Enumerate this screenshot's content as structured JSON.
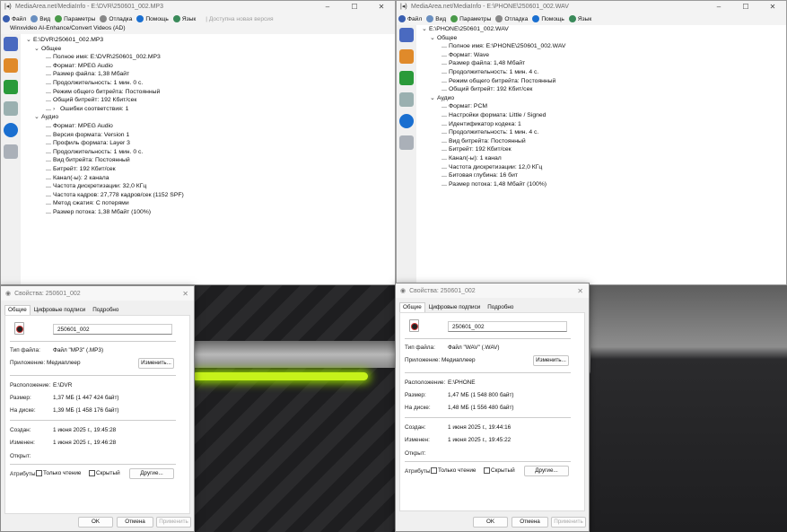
{
  "left_info": {
    "title": "MediaArea.net/MediaInfo - E:\\DVR\\250601_002.MP3",
    "menu": [
      "Файл",
      "Вид",
      "Параметры",
      "Отладка",
      "Помощь",
      "Язык"
    ],
    "update_notice": "| Доступна новая версия",
    "ad": "Winxvideo AI-Enhance/Convert Videos (AD)",
    "tree": [
      {
        "level": 0,
        "text": "E:\\DVR\\250601_002.MP3",
        "caret": "⌄"
      },
      {
        "level": 1,
        "text": "Общее",
        "caret": "⌄"
      },
      {
        "level": 2,
        "text": "Полное имя: E:\\DVR\\250601_002.MP3"
      },
      {
        "level": 2,
        "text": "Формат: MPEG Audio"
      },
      {
        "level": 2,
        "text": "Размер файла: 1,38 Мбайт"
      },
      {
        "level": 2,
        "text": "Продолжительность: 1 мин. 0 с."
      },
      {
        "level": 2,
        "text": "Режим общего битрейта: Постоянный"
      },
      {
        "level": 2,
        "text": "Общий битрейт: 192 Кбит/сек"
      },
      {
        "level": 2,
        "text": "Ошибки соответствия: 1",
        "caret": "›"
      },
      {
        "level": 1,
        "text": "Аудио",
        "caret": "⌄"
      },
      {
        "level": 2,
        "text": "Формат: MPEG Audio"
      },
      {
        "level": 2,
        "text": "Версия формата: Version 1"
      },
      {
        "level": 2,
        "text": "Профиль формата: Layer 3"
      },
      {
        "level": 2,
        "text": "Продолжительность: 1 мин. 0 с."
      },
      {
        "level": 2,
        "text": "Вид битрейта: Постоянный"
      },
      {
        "level": 2,
        "text": "Битрейт: 192 Кбит/сек"
      },
      {
        "level": 2,
        "text": "Канал(-ы): 2 канала"
      },
      {
        "level": 2,
        "text": "Частота дискретизации: 32,0 КГц"
      },
      {
        "level": 2,
        "text": "Частота кадров: 27,778 кадров/сек (1152 SPF)"
      },
      {
        "level": 2,
        "text": "Метод сжатия: С потерями"
      },
      {
        "level": 2,
        "text": "Размер потока: 1,38 Мбайт (100%)"
      }
    ]
  },
  "right_info": {
    "title": "MediaArea.net/MediaInfo - E:\\PHONE\\250601_002.WAV",
    "menu": [
      "Файл",
      "Вид",
      "Параметры",
      "Отладка",
      "Помощь",
      "Язык"
    ],
    "tree": [
      {
        "level": 0,
        "text": "E:\\PHONE\\250601_002.WAV",
        "caret": "⌄"
      },
      {
        "level": 1,
        "text": "Общее",
        "caret": "⌄"
      },
      {
        "level": 2,
        "text": "Полное имя: E:\\PHONE\\250601_002.WAV"
      },
      {
        "level": 2,
        "text": "Формат: Wave"
      },
      {
        "level": 2,
        "text": "Размер файла: 1,48 Мбайт"
      },
      {
        "level": 2,
        "text": "Продолжительность: 1 мин. 4 с."
      },
      {
        "level": 2,
        "text": "Режим общего битрейта: Постоянный"
      },
      {
        "level": 2,
        "text": "Общий битрейт: 192 Кбит/сек"
      },
      {
        "level": 1,
        "text": "Аудио",
        "caret": "⌄"
      },
      {
        "level": 2,
        "text": "Формат: PCM"
      },
      {
        "level": 2,
        "text": "Настройки формата: Little / Signed"
      },
      {
        "level": 2,
        "text": "Идентификатор кодека: 1"
      },
      {
        "level": 2,
        "text": "Продолжительность: 1 мин. 4 с."
      },
      {
        "level": 2,
        "text": "Вид битрейта: Постоянный"
      },
      {
        "level": 2,
        "text": "Битрейт: 192 Кбит/сек"
      },
      {
        "level": 2,
        "text": "Канал(-ы): 1 канал"
      },
      {
        "level": 2,
        "text": "Частота дискретизации: 12,0 КГц"
      },
      {
        "level": 2,
        "text": "Битовая глубина: 16 бит"
      },
      {
        "level": 2,
        "text": "Размер потока: 1,48 Мбайт (100%)"
      }
    ]
  },
  "dialogs": [
    {
      "title": "Свойства: 250601_002",
      "tabs": [
        "Общие",
        "Цифровые подписи",
        "Подробно"
      ],
      "name": "250601_002",
      "type_label": "Тип файла:",
      "type": "Файл \"MP3\" (.MP3)",
      "app_label": "Приложение:",
      "app": "Медиаплеер",
      "change": "Изменить...",
      "loc_label": "Расположение:",
      "loc": "E:\\DVR",
      "size_label": "Размер:",
      "size": "1,37 МБ (1 447 424 байт)",
      "disk_label": "На диске:",
      "disk": "1,39 МБ (1 458 176 байт)",
      "created_label": "Создан:",
      "created": "1 июня 2025 г., 19:45:28",
      "modified_label": "Изменен:",
      "modified": "1 июня 2025 г., 19:46:28",
      "opened_label": "Открыт:",
      "attr_label": "Атрибуты:",
      "readonly": "Только чтение",
      "hidden": "Скрытый",
      "other": "Другие...",
      "ok": "OK",
      "cancel": "Отмена",
      "apply": "Применить"
    },
    {
      "title": "Свойства: 250601_002",
      "tabs": [
        "Общие",
        "Цифровые подписи",
        "Подробно"
      ],
      "name": "250601_002",
      "type_label": "Тип файла:",
      "type": "Файл \"WAV\" (.WAV)",
      "app_label": "Приложение:",
      "app": "Медиаплеер",
      "change": "Изменить...",
      "loc_label": "Расположение:",
      "loc": "E:\\PHONE",
      "size_label": "Размер:",
      "size": "1,47 МБ (1 548 800 байт)",
      "disk_label": "На диске:",
      "disk": "1,48 МБ (1 556 480 байт)",
      "created_label": "Создан:",
      "created": "1 июня 2025 г., 19:44:16",
      "modified_label": "Изменен:",
      "modified": "1 июня 2025 г., 19:45:22",
      "opened_label": "Открыт:",
      "attr_label": "Атрибуты:",
      "readonly": "Только чтение",
      "hidden": "Скрытый",
      "other": "Другие...",
      "ok": "OK",
      "cancel": "Отмена",
      "apply": "Применить"
    }
  ]
}
